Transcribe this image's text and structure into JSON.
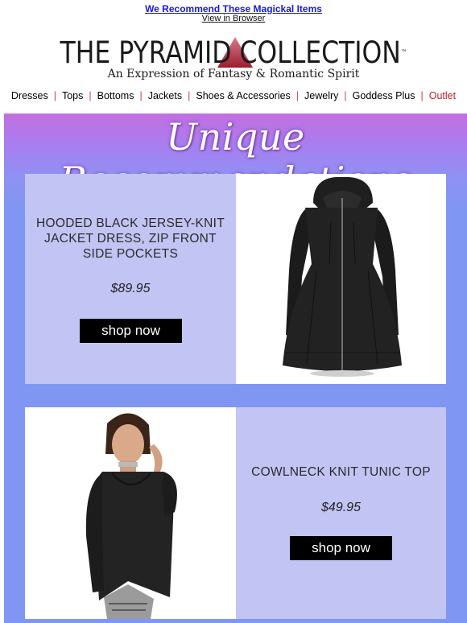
{
  "header": {
    "recommend_link": "We Recommend These Magickal Items",
    "view_in_browser": "View in Browser",
    "logo_title": "THE PYRAMID COLLECTION",
    "logo_tm": "™",
    "logo_tagline": "An Expression of Fantasy & Romantic Spirit"
  },
  "nav": {
    "items": [
      "Dresses",
      "Tops",
      "Bottoms",
      "Jackets",
      "Shoes & Accessories",
      "Jewelry",
      "Goddess Plus",
      "Outlet"
    ],
    "separator": "|",
    "outlet_color": "#c8202a"
  },
  "banner": {
    "title": "Unique Recommendations"
  },
  "products": [
    {
      "name": "HOODED BLACK JERSEY-KNIT JACKET DRESS, ZIP FRONT SIDE POCKETS",
      "price": "$89.95",
      "button": "shop now",
      "image_icon": "hooded-jacket-dress-image"
    },
    {
      "name": "COWLNECK KNIT TUNIC TOP",
      "price": "$49.95",
      "button": "shop now",
      "image_icon": "cowlneck-tunic-model-image"
    }
  ],
  "colors": {
    "card_bg": "#c2c4f4",
    "banner_bg": "#7f96f2",
    "link_blue": "#1a1ad6",
    "button_bg": "#000000"
  }
}
